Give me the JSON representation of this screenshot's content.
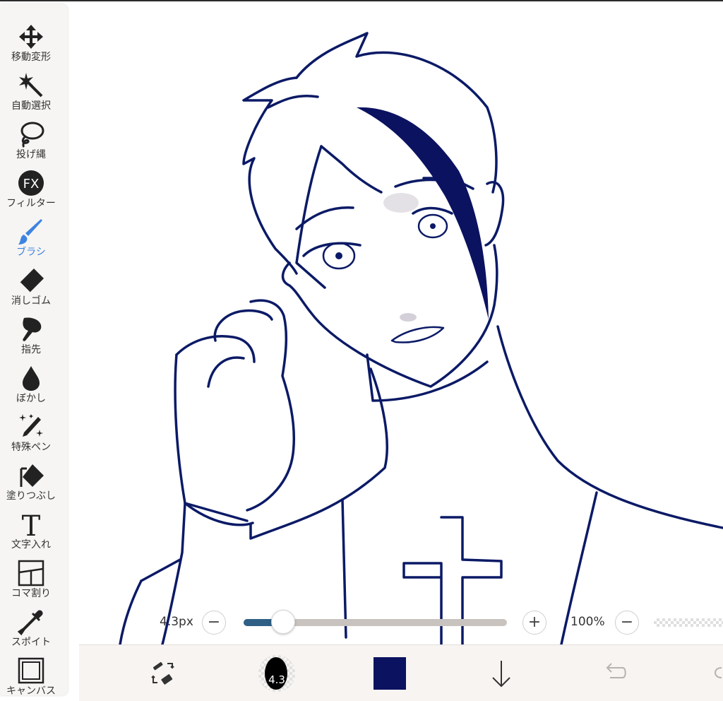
{
  "toolbar": {
    "items": [
      {
        "label": "移動変形",
        "icon": "move-icon"
      },
      {
        "label": "自動選択",
        "icon": "magic-wand-icon"
      },
      {
        "label": "投げ縄",
        "icon": "lasso-icon"
      },
      {
        "label": "フィルター",
        "icon": "fx-icon"
      },
      {
        "label": "ブラシ",
        "icon": "brush-icon"
      },
      {
        "label": "消しゴム",
        "icon": "eraser-icon"
      },
      {
        "label": "指先",
        "icon": "finger-icon"
      },
      {
        "label": "ぼかし",
        "icon": "blur-drop-icon"
      },
      {
        "label": "特殊ペン",
        "icon": "special-pen-icon"
      },
      {
        "label": "塗りつぶし",
        "icon": "fill-icon"
      },
      {
        "label": "文字入れ",
        "icon": "text-icon"
      },
      {
        "label": "コマ割り",
        "icon": "panel-icon"
      },
      {
        "label": "スポイト",
        "icon": "eyedropper-icon"
      },
      {
        "label": "キャンバス",
        "icon": "canvas-icon"
      }
    ],
    "active_index": 4
  },
  "brush_size": {
    "value_text": "4.3px",
    "minus_label": "−",
    "plus_label": "+",
    "slider_fraction": 0.15
  },
  "opacity": {
    "value_text": "100%",
    "minus_label": "−"
  },
  "bottom_bar": {
    "brush_preview_text": "4.3",
    "current_color": "#0b1260"
  },
  "colors": {
    "accent": "#3d84e0",
    "line_color": "#0b1a66"
  }
}
